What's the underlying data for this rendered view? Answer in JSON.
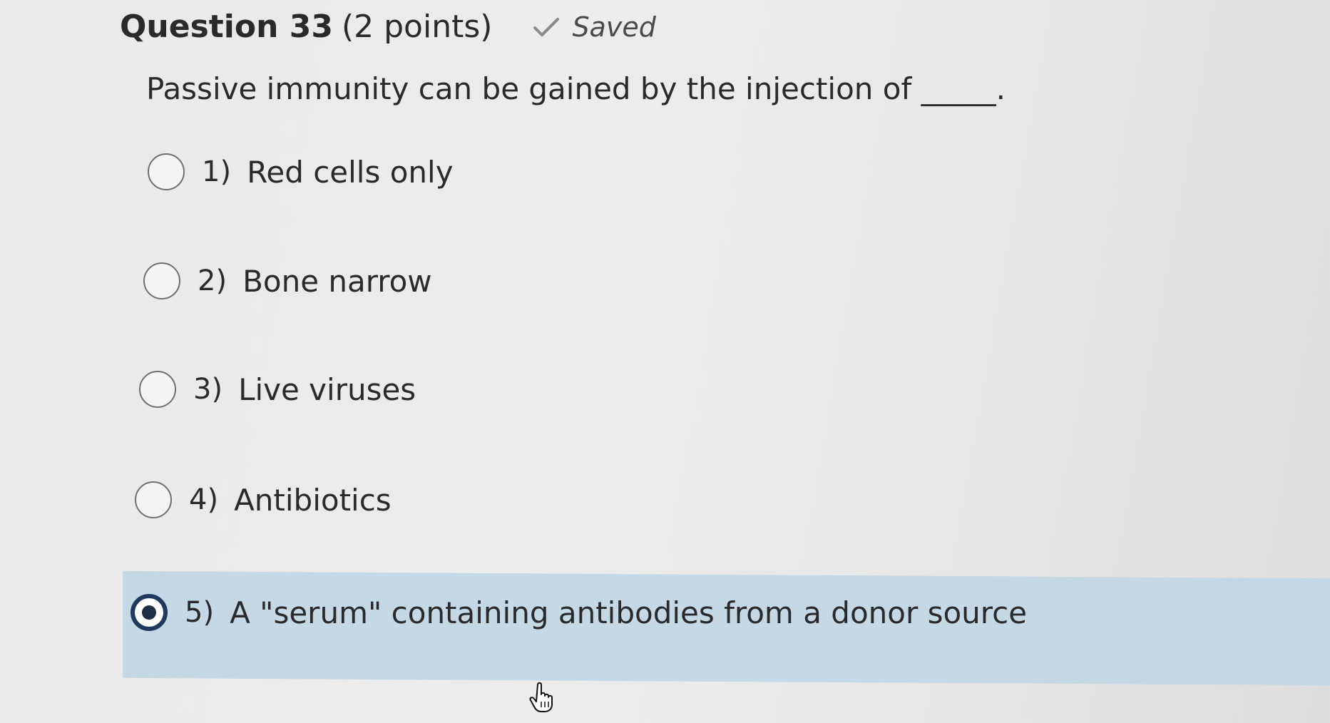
{
  "question": {
    "title": "Question 33",
    "points": "(2 points)",
    "status_icon": "checkmark-icon",
    "status_label": "Saved",
    "text": "Passive immunity can be gained by the injection of _____."
  },
  "options": [
    {
      "number": "1)",
      "label": "Red cells only",
      "selected": false
    },
    {
      "number": "2)",
      "label": "Bone narrow",
      "selected": false
    },
    {
      "number": "3)",
      "label": "Live viruses",
      "selected": false
    },
    {
      "number": "4)",
      "label": "Antibiotics",
      "selected": false
    },
    {
      "number": "5)",
      "label": "A \"serum\" containing antibodies from a donor source",
      "selected": true
    }
  ],
  "colors": {
    "selected_background": "#c5d8e5",
    "selected_radio": "#1f3a5c"
  },
  "cursor_icon": "hand-pointer-icon"
}
